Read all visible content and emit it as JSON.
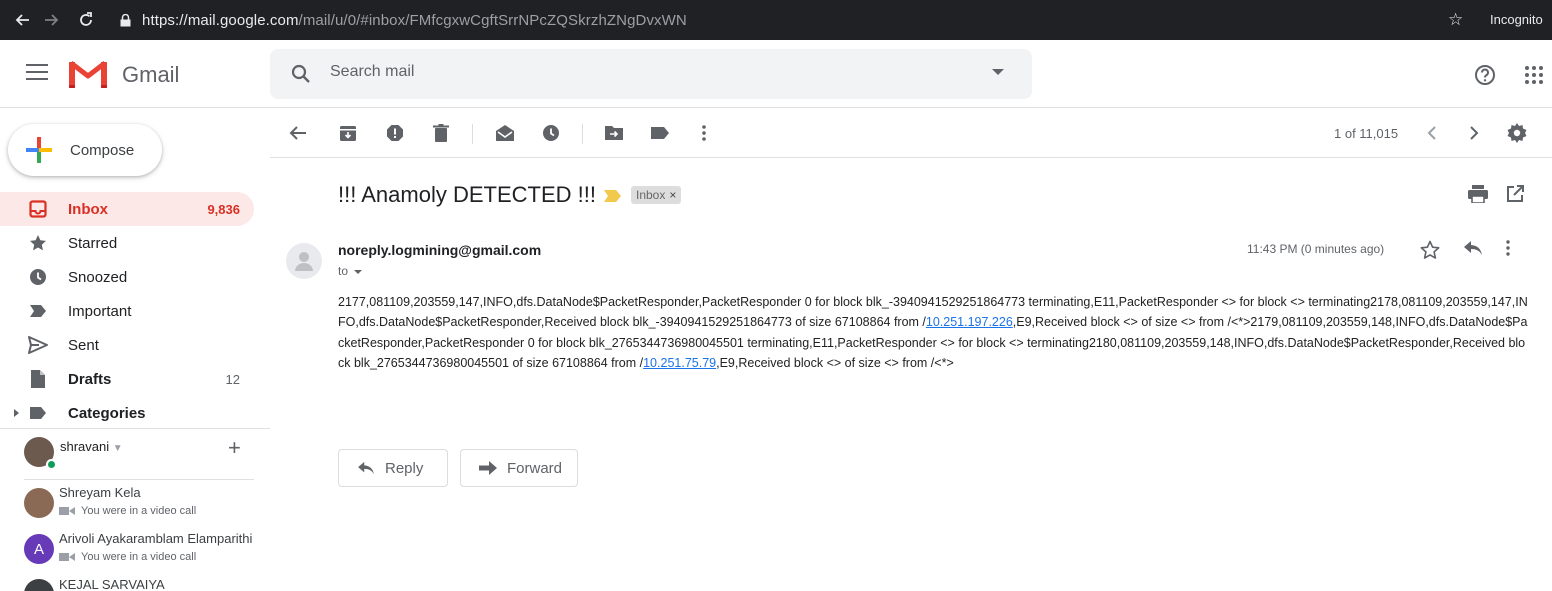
{
  "browser": {
    "url_host": "https://mail.google.com",
    "url_path": "/mail/u/0/#inbox/FMfcgxwCgftSrrNPcZQSkrzhZNgDvxWN",
    "incognito_label": "Incognito",
    "icons": [
      "back-icon",
      "forward-icon",
      "reload-icon",
      "lock-icon",
      "bookmark-star-icon"
    ]
  },
  "header": {
    "app_name": "Gmail",
    "search": {
      "placeholder": "Search mail",
      "value": ""
    },
    "icons": [
      "menu-icon",
      "gmail-logo",
      "search-icon",
      "search-options-icon",
      "help-icon",
      "apps-icon"
    ]
  },
  "sidebar": {
    "compose_label": "Compose",
    "items": [
      {
        "label": "Inbox",
        "count": "9,836",
        "icon": "inbox-icon",
        "active": true
      },
      {
        "label": "Starred",
        "count": "",
        "icon": "star-icon"
      },
      {
        "label": "Snoozed",
        "count": "",
        "icon": "clock-icon"
      },
      {
        "label": "Important",
        "count": "",
        "icon": "important-icon"
      },
      {
        "label": "Sent",
        "count": "",
        "icon": "send-icon"
      },
      {
        "label": "Drafts",
        "count": "12",
        "icon": "draft-icon"
      },
      {
        "label": "Categories",
        "count": "",
        "icon": "label-icon"
      }
    ]
  },
  "hangouts": {
    "me": {
      "name": "shravani",
      "caret": "▼",
      "add": "+"
    },
    "contacts": [
      {
        "name": "Shreyam Kela",
        "status": "You were in a video call"
      },
      {
        "name": "Arivoli Ayakaramblam Elamparithi",
        "status": "You were in a video call",
        "initial": "A"
      },
      {
        "name": "KEJAL SARVAIYA",
        "status": ""
      }
    ]
  },
  "toolbar": {
    "pager": "1 of 11,015",
    "icons": [
      "back-to-inbox-icon",
      "archive-icon",
      "report-spam-icon",
      "delete-icon",
      "mark-unread-icon",
      "snooze-icon",
      "move-to-icon",
      "labels-icon",
      "more-icon",
      "newer-icon",
      "older-icon",
      "settings-icon"
    ]
  },
  "message": {
    "subject": "!!! Anamoly DETECTED !!!",
    "label": "Inbox",
    "label_close": "×",
    "sender": "noreply.logmining@gmail.com",
    "to": "to",
    "timestamp": "11:43 PM (0 minutes ago)",
    "body_part1": "2177,081109,203559,147,INFO,dfs.DataNode$PacketResponder,PacketResponder 0 for block blk_-3940941529251864773 terminating,E11,PacketResponder <> for block <> terminating2178,081109,203559,147,INFO,dfs.DataNode$PacketResponder,Received block blk_-3940941529251864773 of size 67108864 from /",
    "link1": "10.251.197.226",
    "body_part2": ",E9,Received block <> of size <> from /<*>2179,081109,203559,148,INFO,dfs.DataNode$PacketResponder,PacketResponder 0 for block blk_2765344736980045501 terminating,E11,PacketResponder <> for block <> terminating2180,081109,203559,148,INFO,dfs.DataNode$PacketResponder,Received block blk_2765344736980045501 of size 67108864 from /",
    "link2": "10.251.75.79",
    "body_part3": ",E9,Received block <> of size <> from /<*>",
    "reply_label": "Reply",
    "forward_label": "Forward"
  },
  "colors": {
    "browser_bar": "#202124",
    "active_nav_bg": "#fce8e6",
    "active_nav_text": "#d93025",
    "link": "#1a73e8",
    "important_marker": "#f2c94c",
    "presence_online": "#0f9d58"
  }
}
